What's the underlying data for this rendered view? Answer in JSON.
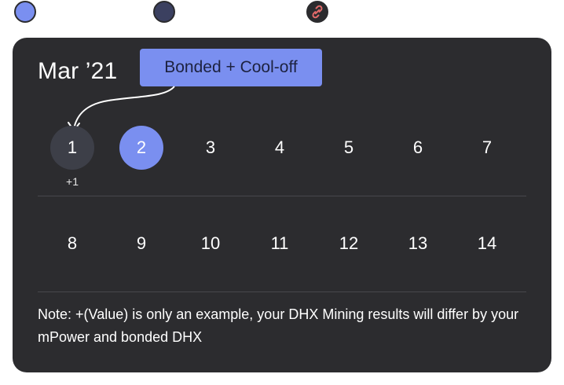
{
  "status_dots": [
    {
      "name": "status-dot-active",
      "color": "#7a8ff0"
    },
    {
      "name": "status-dot-inactive",
      "color": "#3b4060"
    },
    {
      "name": "status-dot-broken-link",
      "icon": "broken-link-icon",
      "color": "#e46a6a"
    }
  ],
  "calendar": {
    "month_label": "Mar ’21",
    "tooltip": "Bonded + Cool-off",
    "weeks": [
      {
        "days": [
          {
            "label": "1",
            "state": "marked",
            "delta": "+1"
          },
          {
            "label": "2",
            "state": "selected",
            "delta": ""
          },
          {
            "label": "3",
            "state": "normal",
            "delta": ""
          },
          {
            "label": "4",
            "state": "normal",
            "delta": ""
          },
          {
            "label": "5",
            "state": "normal",
            "delta": ""
          },
          {
            "label": "6",
            "state": "normal",
            "delta": ""
          },
          {
            "label": "7",
            "state": "normal",
            "delta": ""
          }
        ]
      },
      {
        "days": [
          {
            "label": "8",
            "state": "normal",
            "delta": ""
          },
          {
            "label": "9",
            "state": "normal",
            "delta": ""
          },
          {
            "label": "10",
            "state": "normal",
            "delta": ""
          },
          {
            "label": "11",
            "state": "normal",
            "delta": ""
          },
          {
            "label": "12",
            "state": "normal",
            "delta": ""
          },
          {
            "label": "13",
            "state": "normal",
            "delta": ""
          },
          {
            "label": "14",
            "state": "normal",
            "delta": ""
          }
        ]
      }
    ],
    "note": "Note: +(Value) is only an example, your DHX Mining results will differ by your mPower and bonded DHX"
  },
  "colors": {
    "card_background": "#2c2c2f",
    "accent": "#7a8ff0",
    "marked_day": "#3d3f48",
    "divider": "#47474c"
  }
}
